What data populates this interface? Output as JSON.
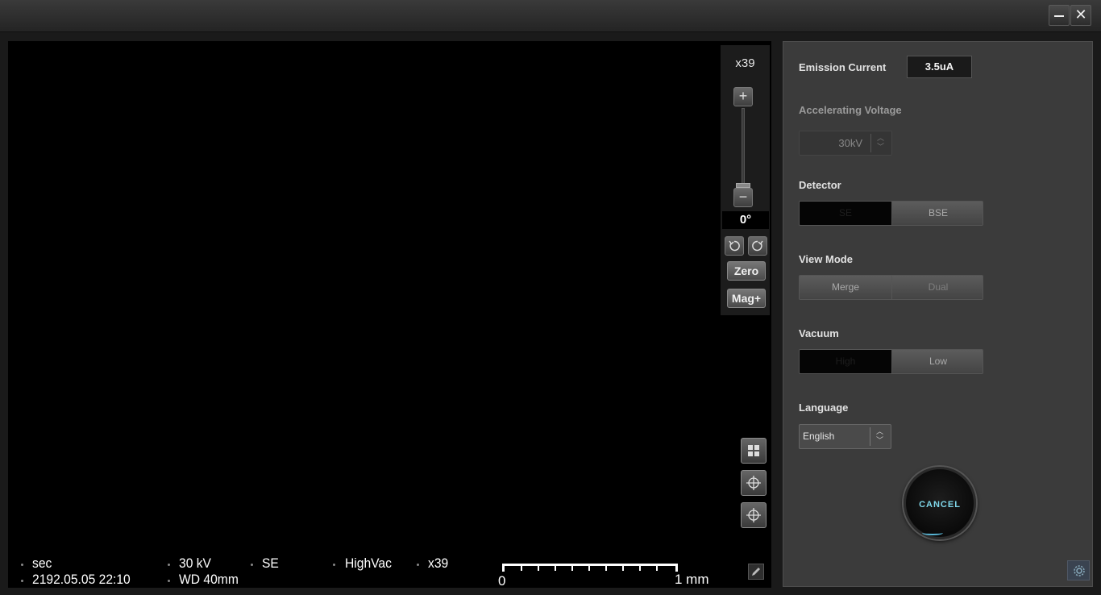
{
  "window": {
    "minimize_icon": "minimize-icon",
    "close_glyph": "✕"
  },
  "viewer": {
    "magnification": "x39",
    "zoom_plus": "+",
    "zoom_minus": "−",
    "rotation_angle": "0°",
    "zero_label": "Zero",
    "mag_plus_label": "Mag+",
    "info": {
      "scan_speed": "sec",
      "datetime": "2192.05.05 22:10",
      "voltage": "30 kV",
      "working_distance": "WD 40mm",
      "detector": "SE",
      "vacuum": "HighVac",
      "magnification": "x39"
    },
    "scale": {
      "start": "0",
      "end": "1 mm"
    },
    "icons": [
      "grid-icon",
      "crosshair-icon",
      "crosshair-icon",
      "pencil-icon",
      "rotate-left-icon",
      "rotate-right-icon"
    ]
  },
  "panel": {
    "emission_label": "Emission Current",
    "emission_value": "3.5uA",
    "voltage_label": "Accelerating Voltage",
    "voltage_value": "30kV",
    "detector_label": "Detector",
    "detector_options": [
      "SE",
      "BSE"
    ],
    "detector_selected": "SE",
    "view_mode_label": "View Mode",
    "view_mode_options": [
      "Merge",
      "Dual"
    ],
    "vacuum_label": "Vacuum",
    "vacuum_options": [
      "High",
      "Low"
    ],
    "vacuum_selected": "High",
    "language_label": "Language",
    "language_value": "English",
    "cancel_label": "CANCEL",
    "cancel_accent": "#7fd7ea"
  }
}
